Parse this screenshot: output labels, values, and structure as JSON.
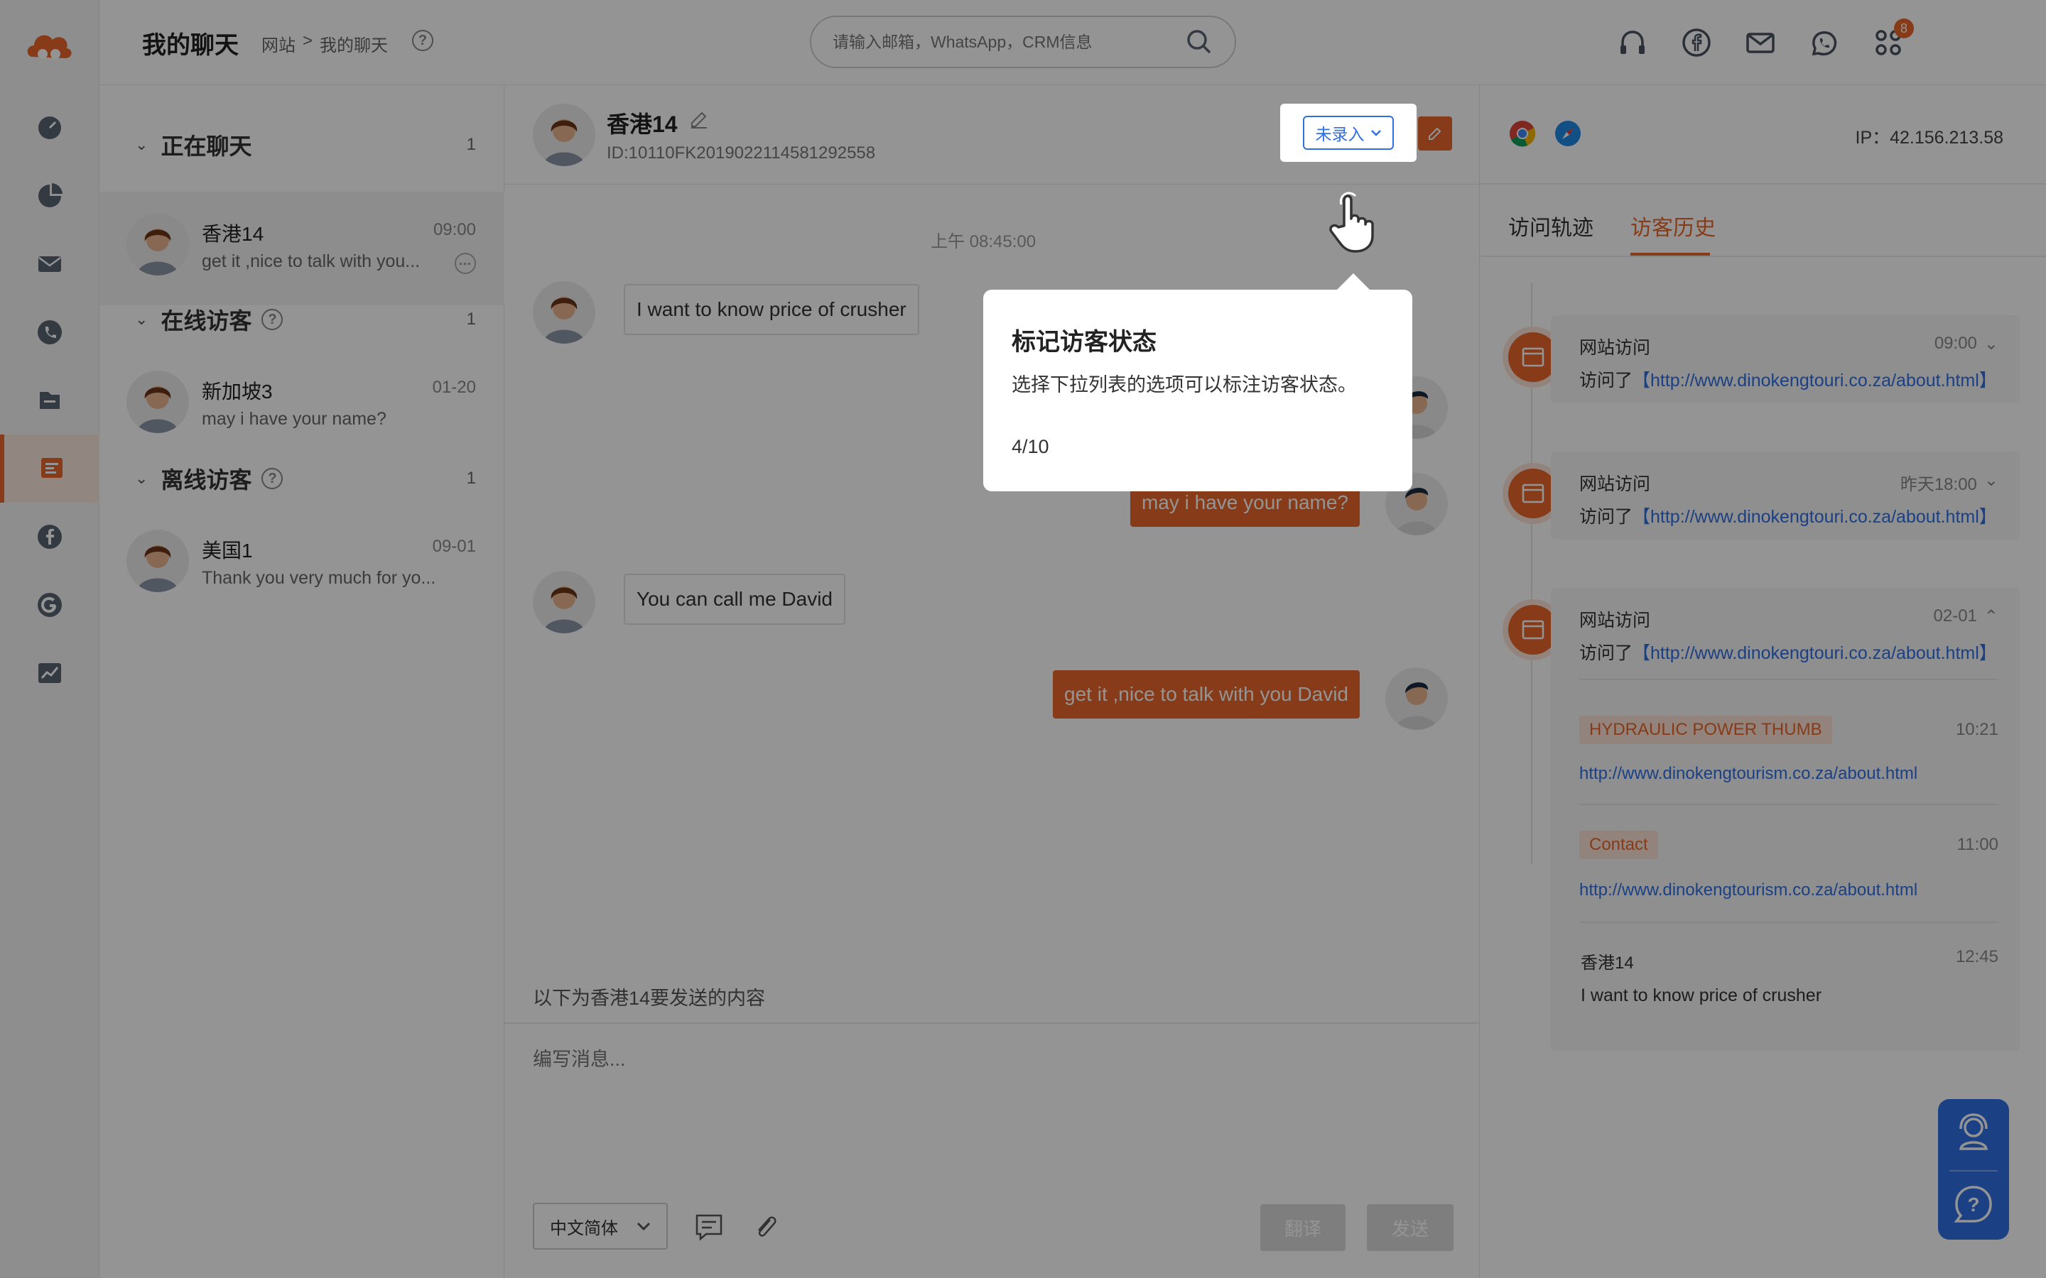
{
  "header": {
    "title": "我的聊天",
    "breadcrumb": [
      "网站",
      ">",
      "我的聊天"
    ],
    "search_placeholder": "请输入邮箱，WhatsApp，CRM信息",
    "apps_badge": "8"
  },
  "sidebar": {
    "items": [
      "dashboard-icon",
      "pie-chart-icon",
      "mail-icon",
      "phone-icon",
      "folder-icon",
      "chat-icon",
      "facebook-icon",
      "google-icon",
      "analytics-icon"
    ],
    "active_index": 5
  },
  "conversations": {
    "groups": [
      {
        "title": "正在聊天",
        "count": "1"
      },
      {
        "title": "在线访客",
        "count": "1"
      },
      {
        "title": "离线访客",
        "count": "1"
      }
    ],
    "items": [
      {
        "name": "香港14",
        "time": "09:00",
        "preview": "get it ,nice to talk with you..."
      },
      {
        "name": "新加坡3",
        "time": "01-20",
        "preview": "may i have your name?"
      },
      {
        "name": "美国1",
        "time": "09-01",
        "preview": "Thank you very much for yo..."
      }
    ]
  },
  "chat": {
    "visitor_name": "香港14",
    "visitor_id": "ID:10110FK2019022114581292558",
    "status_label": "未录入",
    "timestamp": "上午 08:45:00",
    "messages": [
      {
        "dir": "in",
        "text": "I want to know price of crusher"
      },
      {
        "dir": "out",
        "text": "may i have your name?"
      },
      {
        "dir": "in",
        "text": "You can call me David"
      },
      {
        "dir": "out",
        "text": "get it ,nice to talk with you David"
      }
    ],
    "composer_hint": "以下为香港14要发送的内容",
    "composer_placeholder": "编写消息...",
    "language": "中文简体",
    "translate_label": "翻译",
    "send_label": "发送"
  },
  "right_panel": {
    "ip": "IP：42.156.213.58",
    "tabs": [
      "访问轨迹",
      "访客历史"
    ],
    "active_tab": 1,
    "history": [
      {
        "title": "网站访问",
        "time": "09:00",
        "desc": "访问了",
        "link": "【http://www.dinokengtouri.co.za/about.html】"
      },
      {
        "title": "网站访问",
        "time": "昨天18:00",
        "desc": "访问了",
        "link": "【http://www.dinokengtouri.co.za/about.html】"
      },
      {
        "title": "网站访问",
        "time": "02-01",
        "desc": "访问了",
        "link": "【http://www.dinokengtouri.co.za/about.html】",
        "sub_items": [
          {
            "tag": "HYDRAULIC POWER THUMB",
            "time": "10:21",
            "link": "http://www.dinokengtourism.co.za/about.html"
          },
          {
            "tag": "Contact",
            "time": "11:00",
            "link": "http://www.dinokengtourism.co.za/about.html"
          }
        ],
        "last_message": {
          "sender": "香港14",
          "time": "12:45",
          "text": "I want to know price of crusher"
        }
      }
    ]
  },
  "tour": {
    "title": "标记访客状态",
    "body": "选择下拉列表的选项可以标注访客状态。",
    "step": "4/10"
  },
  "colors": {
    "accent": "#e8672a",
    "link": "#2f6fe4",
    "overlay": "rgba(0,0,0,0.42)"
  }
}
